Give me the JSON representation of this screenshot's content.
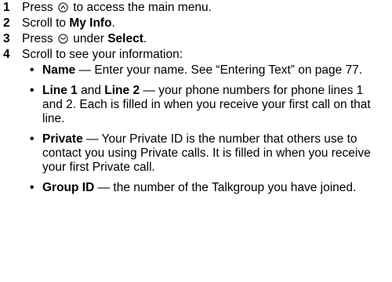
{
  "steps": [
    {
      "num": "1",
      "pre": "Press",
      "icon": "menu-key-icon",
      "post": "to access the main menu."
    },
    {
      "num": "2",
      "pre": "Scroll to",
      "bold": "My Info",
      "post": "."
    },
    {
      "num": "3",
      "pre": "Press",
      "icon": "soft-key-icon",
      "mid": "under",
      "bold": "Select",
      "post": "."
    },
    {
      "num": "4",
      "pre": "Scroll to see your information:"
    }
  ],
  "bullets": [
    {
      "bold": "Name",
      "text": " — Enter your name. See “Entering Text” on page 77."
    },
    {
      "bold": "Line 1",
      "mid": " and ",
      "bold2": "Line 2",
      "text": " — your phone numbers for phone lines 1 and 2. Each is filled in when you receive your first call on that line."
    },
    {
      "bold": "Private",
      "text": " — Your Private ID is the number that others use to contact you using Private calls. It is filled in when you receive your first Private call."
    },
    {
      "bold": "Group ID",
      "text": " — the number of the Talkgroup you have joined."
    }
  ],
  "bullet_glyph": "•"
}
